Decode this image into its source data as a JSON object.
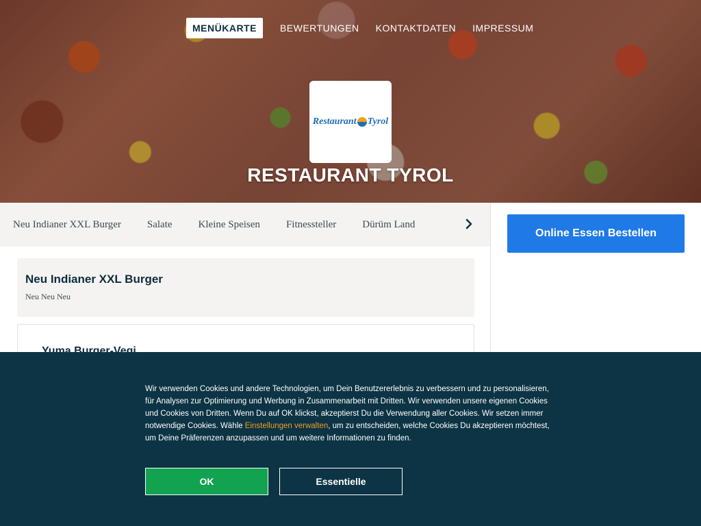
{
  "nav": {
    "items": [
      {
        "label": "MENÜKARTE",
        "active": true
      },
      {
        "label": "BEWERTUNGEN",
        "active": false
      },
      {
        "label": "KONTAKTDATEN",
        "active": false
      },
      {
        "label": "IMPRESSUM",
        "active": false
      }
    ]
  },
  "logo": {
    "text_left": "Restaurant",
    "text_right": "Tyrol"
  },
  "restaurant": {
    "name": "RESTAURANT TYROL"
  },
  "categories": [
    "Neu Indianer XXL Burger",
    "Salate",
    "Kleine Speisen",
    "Fitnessteller",
    "Dürüm Land"
  ],
  "order_button": {
    "label": "Online Essen Bestellen"
  },
  "menu": {
    "section_title": "Neu Indianer XXL Burger",
    "section_subtitle": "Neu Neu Neu",
    "first_item": "Yuma Burger-Vegi"
  },
  "cookie": {
    "text_before_link": "Wir verwenden Cookies und andere Technologien, um Dein Benutzererlebnis zu verbessern und zu personalisieren, für Analysen zur Optimierung und Werbung in Zusammenarbeit mit Dritten. Wir verwenden unsere eigenen Cookies und Cookies von Dritten. Wenn Du auf OK klickst, akzeptierst Du die Verwendung aller Cookies. Wir setzen immer notwendige Cookies. Wähle ",
    "link": "Einstellungen verwalten",
    "text_after_link": ", um zu entscheiden, welche Cookies Du akzeptieren möchtest, um Deine Präferenzen anzupassen und um weitere Informationen zu finden.",
    "ok_label": "OK",
    "essential_label": "Essentielle"
  },
  "colors": {
    "brand_dark": "#0c2d3f",
    "order_blue": "#1f7ae8",
    "cookie_bg": "#0c3444",
    "ok_green": "#12a350",
    "link_orange": "#f39c27"
  }
}
